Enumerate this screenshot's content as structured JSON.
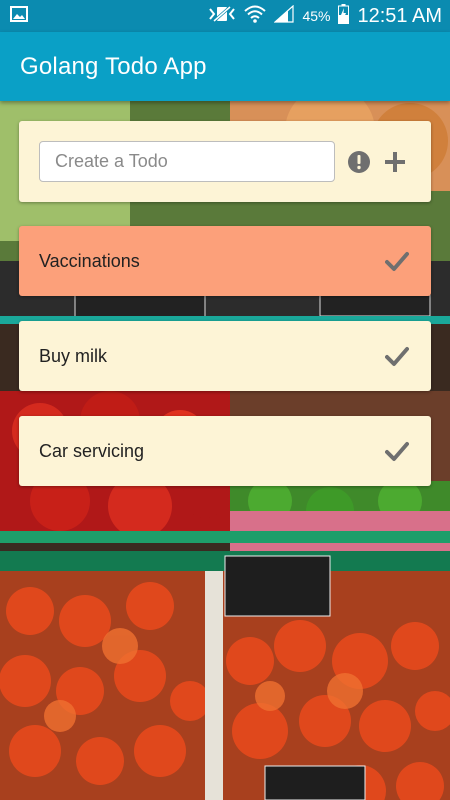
{
  "status_bar": {
    "battery": "45%",
    "time": "12:51 AM",
    "icons": [
      "image-icon",
      "mute-vibrate-icon",
      "wifi-icon",
      "signal-icon",
      "battery-charging-icon"
    ]
  },
  "app_bar": {
    "title": "Golang Todo App"
  },
  "create": {
    "placeholder": "Create a Todo",
    "value": "",
    "icons": [
      "alert-icon",
      "plus-icon"
    ]
  },
  "todos": [
    {
      "label": "Vaccinations",
      "highlight_color": "#fca07a"
    },
    {
      "label": "Buy milk",
      "highlight_color": "#fdf4d6"
    },
    {
      "label": "Car servicing",
      "highlight_color": "#fdf4d6"
    }
  ],
  "colors": {
    "status_bar": "#0b8bb0",
    "app_bar": "#0aa0c6",
    "card": "#fdf4d6",
    "highlight": "#fca07a",
    "icon": "#6f6f6f"
  }
}
